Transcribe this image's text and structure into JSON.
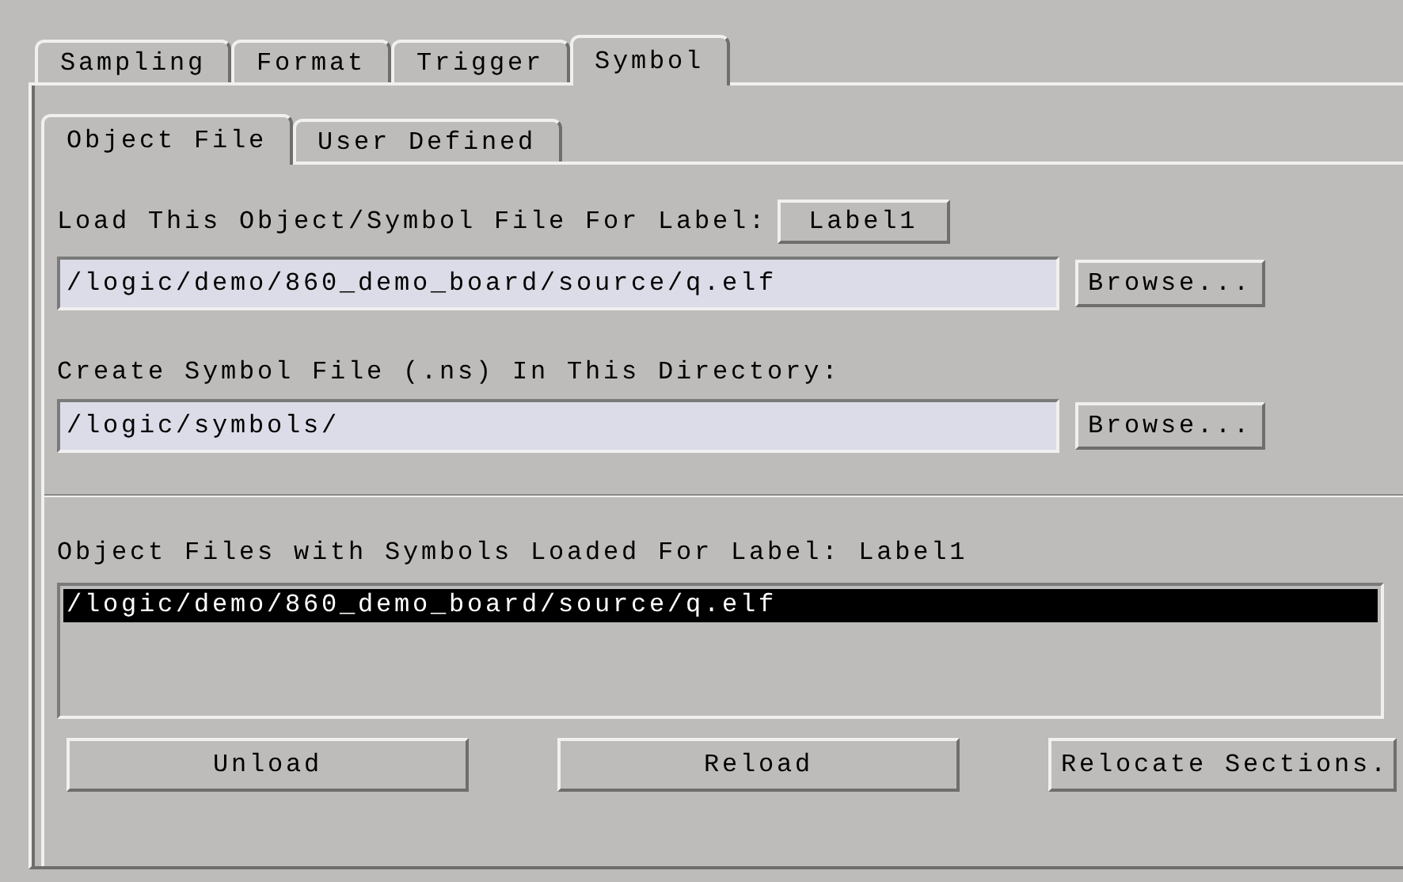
{
  "tabs": [
    {
      "label": "Sampling",
      "selected": false
    },
    {
      "label": "Format",
      "selected": false
    },
    {
      "label": "Trigger",
      "selected": false
    },
    {
      "label": "Symbol",
      "selected": true
    }
  ],
  "subtabs": [
    {
      "label": "Object File",
      "selected": true
    },
    {
      "label": "User Defined",
      "selected": false
    }
  ],
  "load_label": "Load This Object/Symbol File For Label:",
  "label_button": "Label1",
  "object_file": {
    "value": "/logic/demo/860_demo_board/source/q.elf",
    "browse": "Browse..."
  },
  "directory_label": "Create Symbol File (.ns) In This Directory:",
  "directory": {
    "value": "/logic/symbols/",
    "browse": "Browse..."
  },
  "loaded_label": "Object Files with Symbols Loaded For Label: Label1",
  "loaded_files": [
    {
      "name": "/logic/demo/860_demo_board/source/q.elf",
      "selected": true
    }
  ],
  "buttons": [
    "Unload",
    "Reload",
    "Relocate Sections."
  ]
}
